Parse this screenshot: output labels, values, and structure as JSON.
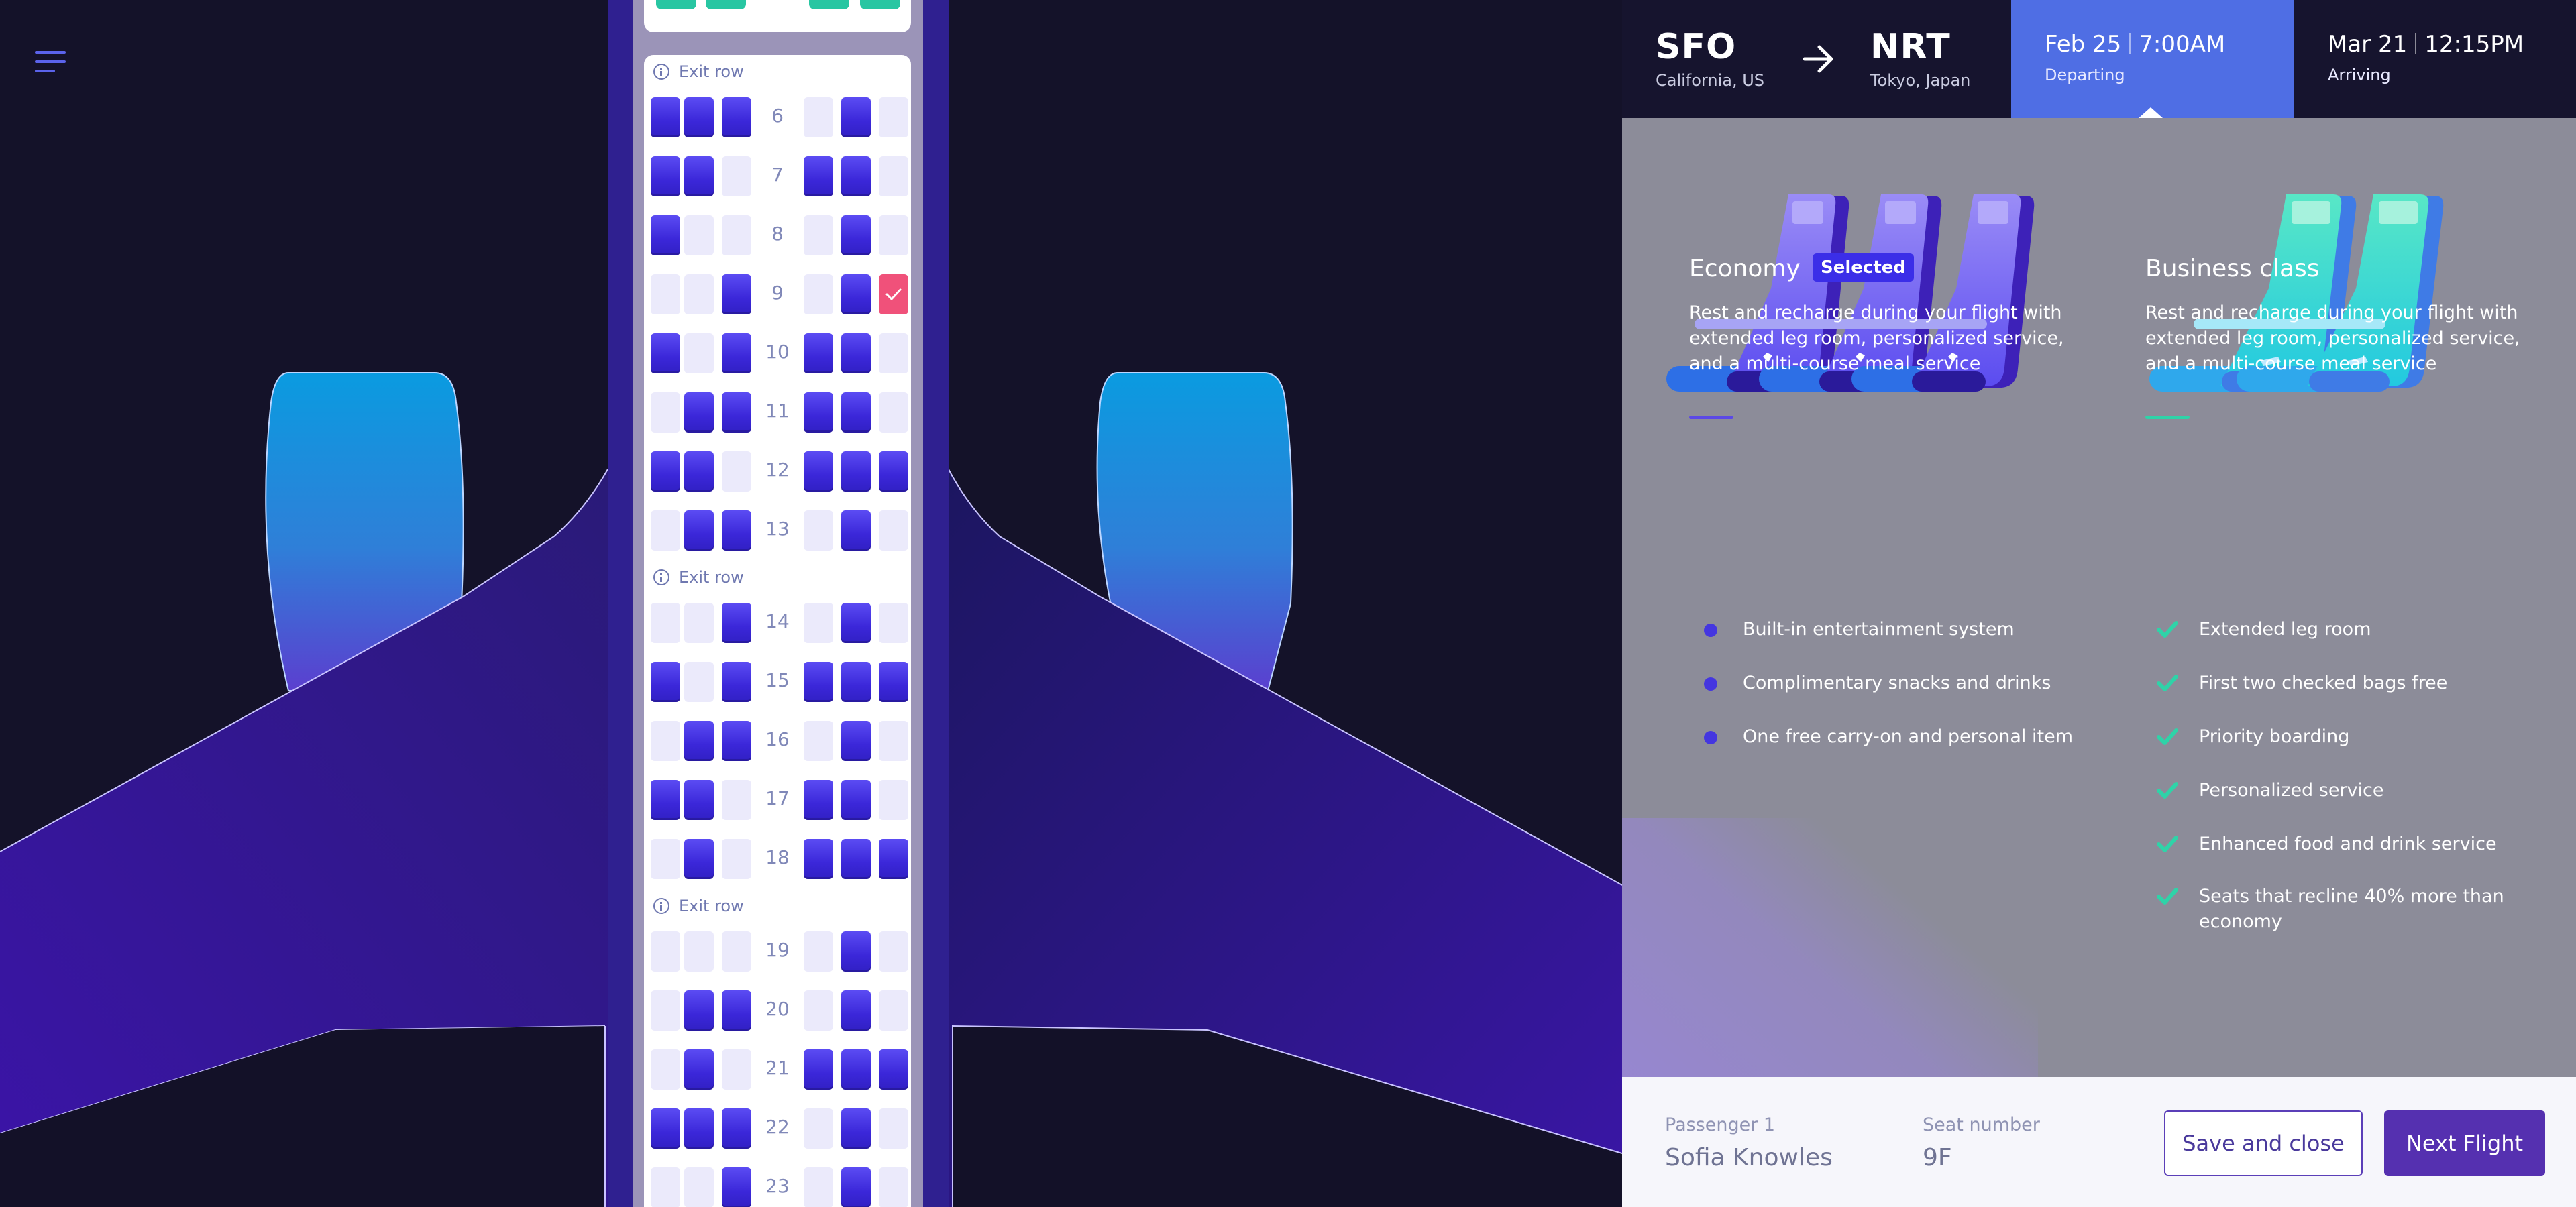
{
  "header": {
    "origin": {
      "code": "SFO",
      "place": "California, US"
    },
    "destination": {
      "code": "NRT",
      "place": "Tokyo, Japan"
    },
    "departing": {
      "date": "Feb 25",
      "time": "7:00AM",
      "label": "Departing"
    },
    "arriving": {
      "date": "Mar 21",
      "time": "12:15PM",
      "label": "Arriving"
    }
  },
  "seatmap": {
    "exit_label": "Exit row",
    "rows": [
      {
        "num": "6",
        "seats": [
          "taken",
          "taken",
          "taken",
          "free",
          "taken",
          "free"
        ]
      },
      {
        "num": "7",
        "seats": [
          "taken",
          "taken",
          "free",
          "taken",
          "taken",
          "free"
        ]
      },
      {
        "num": "8",
        "seats": [
          "taken",
          "free",
          "free",
          "free",
          "taken",
          "free"
        ]
      },
      {
        "num": "9",
        "seats": [
          "free",
          "free",
          "taken",
          "free",
          "taken",
          "selected"
        ]
      },
      {
        "num": "10",
        "seats": [
          "taken",
          "free",
          "taken",
          "taken",
          "taken",
          "free"
        ]
      },
      {
        "num": "11",
        "seats": [
          "free",
          "taken",
          "taken",
          "taken",
          "taken",
          "free"
        ]
      },
      {
        "num": "12",
        "seats": [
          "taken",
          "taken",
          "free",
          "taken",
          "taken",
          "taken"
        ]
      },
      {
        "num": "13",
        "seats": [
          "free",
          "taken",
          "taken",
          "free",
          "taken",
          "free"
        ]
      },
      {
        "num": "14",
        "seats": [
          "free",
          "free",
          "taken",
          "free",
          "taken",
          "free"
        ]
      },
      {
        "num": "15",
        "seats": [
          "taken",
          "free",
          "taken",
          "taken",
          "taken",
          "taken"
        ]
      },
      {
        "num": "16",
        "seats": [
          "free",
          "taken",
          "taken",
          "free",
          "taken",
          "free"
        ]
      },
      {
        "num": "17",
        "seats": [
          "taken",
          "taken",
          "free",
          "taken",
          "taken",
          "free"
        ]
      },
      {
        "num": "18",
        "seats": [
          "free",
          "taken",
          "free",
          "taken",
          "taken",
          "taken"
        ]
      },
      {
        "num": "19",
        "seats": [
          "free",
          "free",
          "free",
          "free",
          "taken",
          "free"
        ]
      },
      {
        "num": "20",
        "seats": [
          "free",
          "taken",
          "taken",
          "free",
          "taken",
          "free"
        ]
      },
      {
        "num": "21",
        "seats": [
          "free",
          "taken",
          "free",
          "taken",
          "taken",
          "taken"
        ]
      },
      {
        "num": "22",
        "seats": [
          "taken",
          "taken",
          "taken",
          "free",
          "taken",
          "free"
        ]
      },
      {
        "num": "23",
        "seats": [
          "free",
          "free",
          "taken",
          "free",
          "taken",
          "free"
        ]
      }
    ]
  },
  "economy": {
    "title": "Economy",
    "badge": "Selected",
    "description": "Rest and recharge during your flight with extended leg room, personalized service, and a multi-course meal service",
    "features": [
      "Built-in entertainment system",
      "Complimentary snacks and drinks",
      "One free carry-on and personal item"
    ]
  },
  "business": {
    "title": "Business class",
    "description": "Rest and recharge during your flight with extended leg room, personalized service, and a multi-course meal service",
    "features": [
      "Extended leg room",
      "First two checked bags free",
      "Priority boarding",
      "Personalized service",
      "Enhanced food and drink service",
      "Seats that recline 40% more than economy"
    ]
  },
  "footer": {
    "passenger_label": "Passenger 1",
    "passenger_name": "Sofia Knowles",
    "seat_label": "Seat number",
    "seat_value": "9F",
    "save_label": "Save and close",
    "next_label": "Next Flight"
  },
  "colors": {
    "accent": "#4f6ee4",
    "seat_taken": "#4636e6",
    "seat_free": "#ebeafb",
    "seat_selected": "#f0517a",
    "business_accent": "#2fd3a8",
    "primary_button": "#5530b0"
  },
  "icons": {
    "menu": "hamburger-menu-icon",
    "arrow": "arrow-right-icon",
    "exit": "info-icon",
    "check": "check-icon"
  }
}
